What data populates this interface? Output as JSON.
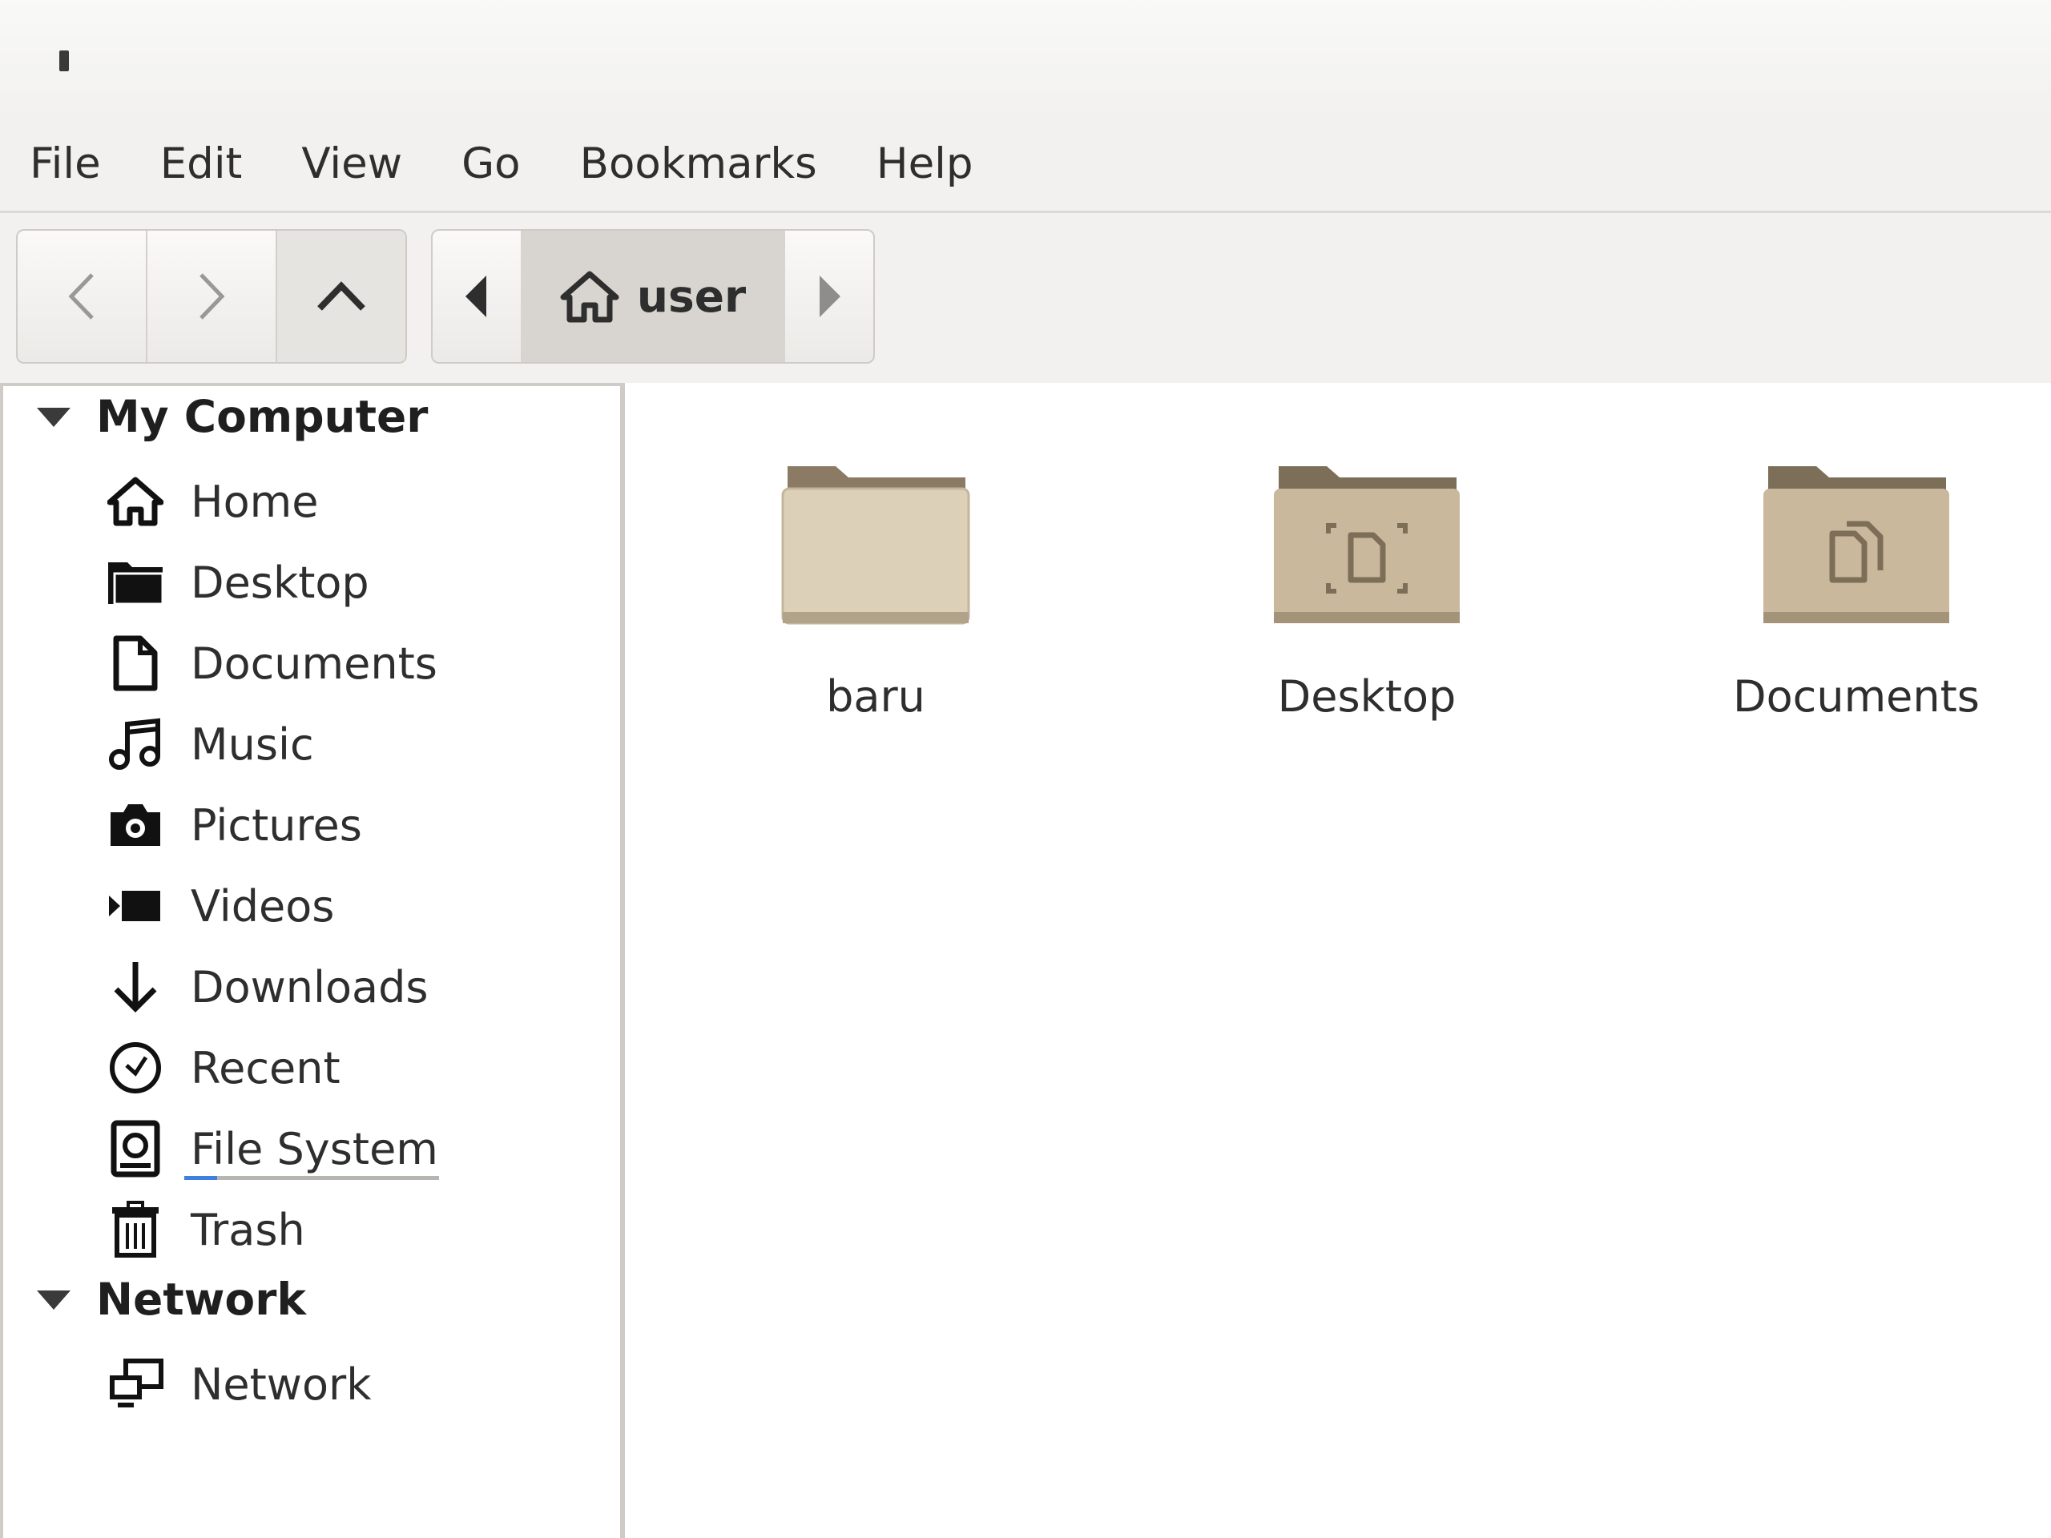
{
  "window": {
    "title_icon": "app-glyph"
  },
  "menubar": {
    "items": [
      {
        "label": "File"
      },
      {
        "label": "Edit"
      },
      {
        "label": "View"
      },
      {
        "label": "Go"
      },
      {
        "label": "Bookmarks"
      },
      {
        "label": "Help"
      }
    ]
  },
  "toolbar": {
    "back_icon": "chevron-left-icon",
    "forward_icon": "chevron-right-icon",
    "up_icon": "chevron-up-icon",
    "path": {
      "current": "user",
      "icon": "home-icon"
    }
  },
  "sidebar": {
    "sections": [
      {
        "title": "My Computer",
        "items": [
          {
            "label": "Home",
            "icon": "home-icon"
          },
          {
            "label": "Desktop",
            "icon": "folder-icon"
          },
          {
            "label": "Documents",
            "icon": "document-icon"
          },
          {
            "label": "Music",
            "icon": "music-icon"
          },
          {
            "label": "Pictures",
            "icon": "camera-icon"
          },
          {
            "label": "Videos",
            "icon": "video-icon"
          },
          {
            "label": "Downloads",
            "icon": "download-icon"
          },
          {
            "label": "Recent",
            "icon": "clock-icon"
          },
          {
            "label": "File System",
            "icon": "drive-icon",
            "usage_fraction": 0.13
          },
          {
            "label": "Trash",
            "icon": "trash-icon"
          }
        ]
      },
      {
        "title": "Network",
        "items": [
          {
            "label": "Network",
            "icon": "network-icon"
          }
        ]
      }
    ]
  },
  "files": [
    {
      "name": "baru",
      "icon": "folder-icon"
    },
    {
      "name": "Desktop",
      "icon": "desktop-folder-icon"
    },
    {
      "name": "Documents",
      "icon": "documents-folder-icon"
    }
  ],
  "colors": {
    "accent": "#3d80e0",
    "folder": "#d7c8ae",
    "folder_tab": "#8b7b64"
  }
}
